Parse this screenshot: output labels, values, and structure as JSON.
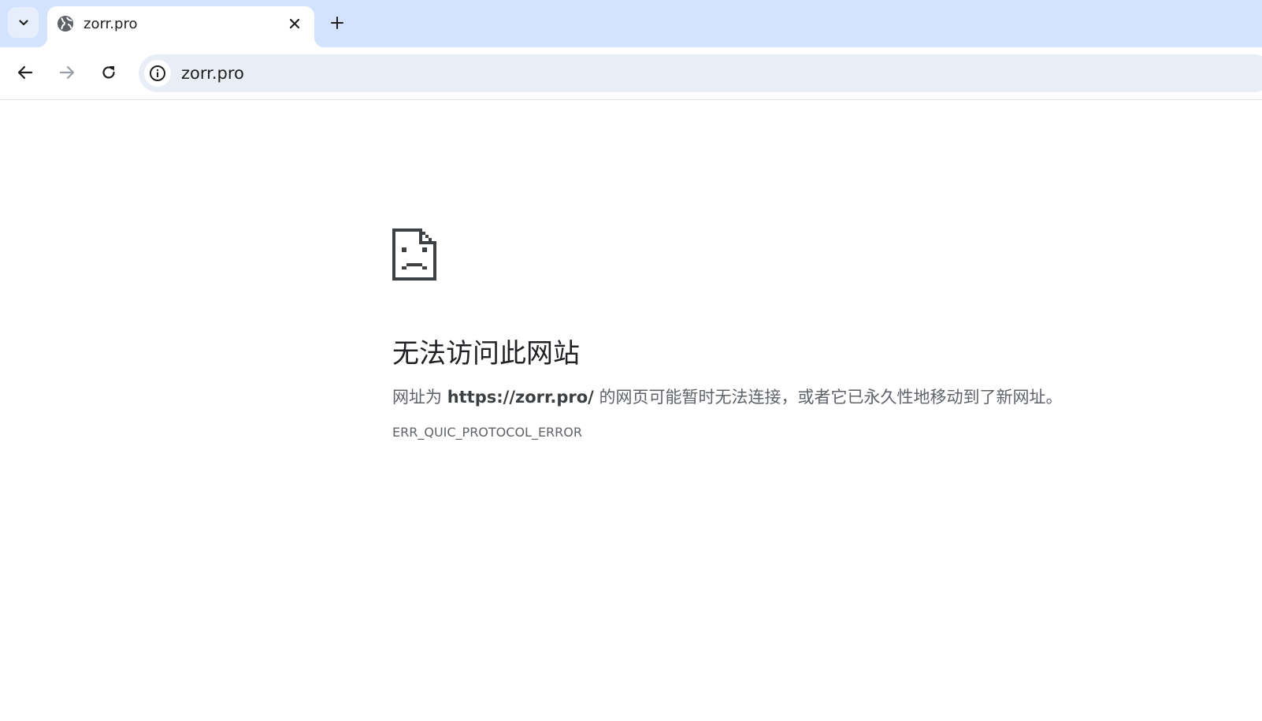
{
  "tabstrip": {
    "tab_search_icon": "chevron-down-icon",
    "active_tab": {
      "title": "zorr.pro",
      "favicon": "globe-icon",
      "close_icon": "close-icon"
    },
    "new_tab_icon": "plus-icon",
    "background_color": "#d3e3fd"
  },
  "toolbar": {
    "back_icon": "arrow-left-icon",
    "forward_icon": "arrow-right-icon",
    "reload_icon": "reload-icon",
    "omnibox": {
      "info_icon": "info-icon",
      "url": "zorr.pro",
      "background_color": "#e9eef6"
    }
  },
  "error_page": {
    "icon": "sad-document-icon",
    "title": "无法访问此网站",
    "description_prefix": "网址为 ",
    "description_url": "https://zorr.pro/",
    "description_suffix": " 的网页可能暂时无法连接，或者它已永久性地移动到了新网址。",
    "error_code": "ERR_QUIC_PROTOCOL_ERROR"
  }
}
